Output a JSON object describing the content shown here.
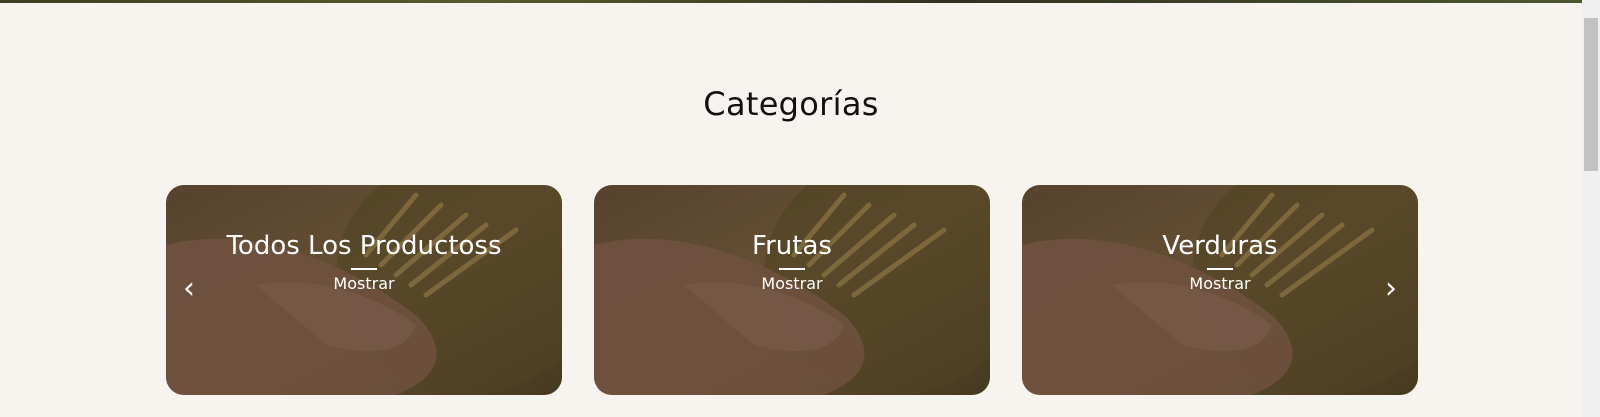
{
  "section": {
    "title": "Categorías"
  },
  "carousel": {
    "prev_label": "‹",
    "next_label": "›",
    "cards": [
      {
        "name": "Todos Los Productoss",
        "cta": "Mostrar"
      },
      {
        "name": "Frutas",
        "cta": "Mostrar"
      },
      {
        "name": "Verduras",
        "cta": "Mostrar"
      }
    ]
  },
  "colors": {
    "page_background": "#f7f4f0",
    "title_text": "#111111",
    "card_text": "#ffffff",
    "scrollbar_thumb": "#c2c2c2"
  },
  "icons": {
    "prev": "chevron-left-icon",
    "next": "chevron-right-icon"
  }
}
